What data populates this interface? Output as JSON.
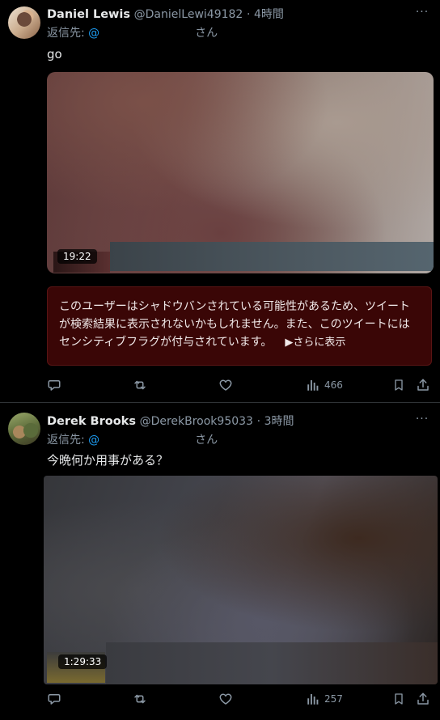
{
  "tweets": [
    {
      "name": "Daniel Lewis",
      "handle": "@DanielLewi49182",
      "separator": "·",
      "time": "4時間",
      "more": "···",
      "reply_prefix": "返信先:",
      "reply_at": "@",
      "reply_suffix": "さん",
      "text": "go",
      "media": {
        "duration": "19:22"
      },
      "warning": {
        "text": "このユーザーはシャドウバンされている可能性があるため、ツイートが検索結果に表示されないかもしれません。また、このツイートにはセンシティブフラグが付与されています。",
        "show_more": "▶さらに表示"
      },
      "actions": {
        "views": "466"
      }
    },
    {
      "name": "Derek Brooks",
      "handle": "@DerekBrook95033",
      "separator": "·",
      "time": "3時間",
      "more": "···",
      "reply_prefix": "返信先:",
      "reply_at": "@",
      "reply_suffix": "さん",
      "text": "今晩何か用事がある？",
      "media": {
        "duration": "1:29:33"
      },
      "actions": {
        "views": "257"
      }
    }
  ],
  "colors": {
    "background": "#000000",
    "text": "#e7e9ea",
    "muted": "#8b98a5",
    "link": "#1d9bf0",
    "warning_bg": "#3a0606"
  },
  "icons": [
    "reply-icon",
    "retweet-icon",
    "like-icon",
    "views-icon",
    "bookmark-icon",
    "share-icon",
    "more-icon"
  ]
}
